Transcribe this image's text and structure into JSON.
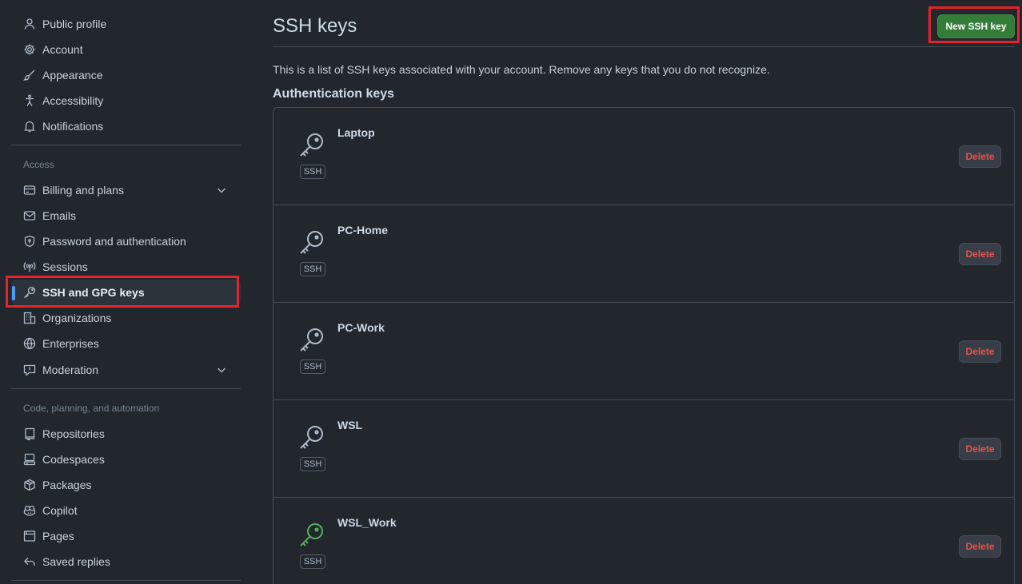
{
  "sidebar": {
    "items_top": [
      {
        "label": "Public profile",
        "icon": "person-icon"
      },
      {
        "label": "Account",
        "icon": "gear-icon"
      },
      {
        "label": "Appearance",
        "icon": "paintbrush-icon"
      },
      {
        "label": "Accessibility",
        "icon": "accessibility-icon"
      },
      {
        "label": "Notifications",
        "icon": "bell-icon"
      }
    ],
    "access_heading": "Access",
    "items_access": [
      {
        "label": "Billing and plans",
        "icon": "credit-card-icon"
      },
      {
        "label": "Emails",
        "icon": "mail-icon"
      },
      {
        "label": "Password and authentication",
        "icon": "shield-lock-icon"
      },
      {
        "label": "Sessions",
        "icon": "broadcast-icon"
      },
      {
        "label": "SSH and GPG keys",
        "icon": "key-icon"
      },
      {
        "label": "Organizations",
        "icon": "organization-icon"
      },
      {
        "label": "Enterprises",
        "icon": "globe-icon"
      },
      {
        "label": "Moderation",
        "icon": "report-icon"
      }
    ],
    "code_heading": "Code, planning, and automation",
    "items_code": [
      {
        "label": "Repositories",
        "icon": "repo-icon"
      },
      {
        "label": "Codespaces",
        "icon": "codespaces-icon"
      },
      {
        "label": "Packages",
        "icon": "package-icon"
      },
      {
        "label": "Copilot",
        "icon": "copilot-icon"
      },
      {
        "label": "Pages",
        "icon": "browser-icon"
      },
      {
        "label": "Saved replies",
        "icon": "reply-icon"
      }
    ],
    "active_item": "SSH and GPG keys"
  },
  "main": {
    "title": "SSH keys",
    "new_button": "New SSH key",
    "description": "This is a list of SSH keys associated with your account. Remove any keys that you do not recognize.",
    "section_heading": "Authentication keys",
    "keys": [
      {
        "name": "Laptop",
        "type": "SSH",
        "delete_label": "Delete",
        "icon_color": "#adbac7"
      },
      {
        "name": "PC-Home",
        "type": "SSH",
        "delete_label": "Delete",
        "icon_color": "#adbac7"
      },
      {
        "name": "PC-Work",
        "type": "SSH",
        "delete_label": "Delete",
        "icon_color": "#adbac7"
      },
      {
        "name": "WSL",
        "type": "SSH",
        "delete_label": "Delete",
        "icon_color": "#adbac7"
      },
      {
        "name": "WSL_Work",
        "type": "SSH",
        "delete_label": "Delete",
        "icon_color": "#57ab5a"
      }
    ]
  },
  "colors": {
    "background": "#22272e",
    "primary_button": "#347d39",
    "danger": "#e5534b",
    "highlight_box": "#e5232b",
    "active_indicator": "#539bf5"
  }
}
